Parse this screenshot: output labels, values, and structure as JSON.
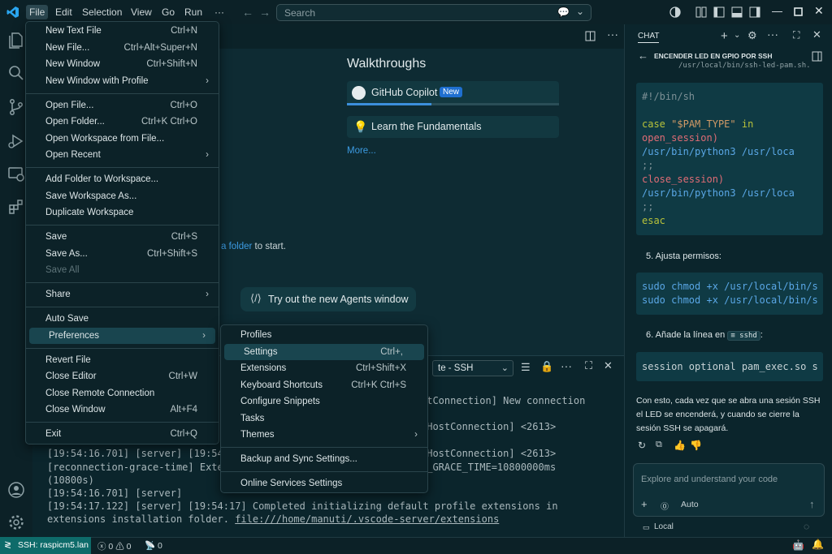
{
  "titlebar": {
    "menus": [
      "File",
      "Edit",
      "Selection",
      "View",
      "Go",
      "Run",
      "···"
    ],
    "search_placeholder": "Search"
  },
  "file_menu": {
    "groups": [
      [
        {
          "label": "New Text File",
          "shortcut": "Ctrl+N"
        },
        {
          "label": "New File...",
          "shortcut": "Ctrl+Alt+Super+N"
        },
        {
          "label": "New Window",
          "shortcut": "Ctrl+Shift+N"
        },
        {
          "label": "New Window with Profile",
          "shortcut": "",
          "submenu": true
        }
      ],
      [
        {
          "label": "Open File...",
          "shortcut": "Ctrl+O"
        },
        {
          "label": "Open Folder...",
          "shortcut": "Ctrl+K Ctrl+O"
        },
        {
          "label": "Open Workspace from File...",
          "shortcut": ""
        },
        {
          "label": "Open Recent",
          "shortcut": "",
          "submenu": true
        }
      ],
      [
        {
          "label": "Add Folder to Workspace...",
          "shortcut": ""
        },
        {
          "label": "Save Workspace As...",
          "shortcut": ""
        },
        {
          "label": "Duplicate Workspace",
          "shortcut": ""
        }
      ],
      [
        {
          "label": "Save",
          "shortcut": "Ctrl+S"
        },
        {
          "label": "Save As...",
          "shortcut": "Ctrl+Shift+S"
        },
        {
          "label": "Save All",
          "shortcut": "",
          "disabled": true
        }
      ],
      [
        {
          "label": "Share",
          "shortcut": "",
          "submenu": true
        }
      ],
      [
        {
          "label": "Auto Save",
          "shortcut": ""
        },
        {
          "label": "Preferences",
          "shortcut": "",
          "submenu": true,
          "highlight": true
        }
      ],
      [
        {
          "label": "Revert File",
          "shortcut": ""
        },
        {
          "label": "Close Editor",
          "shortcut": "Ctrl+W"
        },
        {
          "label": "Close Remote Connection",
          "shortcut": ""
        },
        {
          "label": "Close Window",
          "shortcut": "Alt+F4"
        }
      ],
      [
        {
          "label": "Exit",
          "shortcut": "Ctrl+Q"
        }
      ]
    ]
  },
  "prefs_menu": {
    "groups": [
      [
        {
          "label": "Profiles",
          "shortcut": ""
        },
        {
          "label": "Settings",
          "shortcut": "Ctrl+,",
          "highlight": true
        },
        {
          "label": "Extensions",
          "shortcut": "Ctrl+Shift+X"
        },
        {
          "label": "Keyboard Shortcuts",
          "shortcut": "Ctrl+K Ctrl+S"
        },
        {
          "label": "Configure Snippets",
          "shortcut": ""
        },
        {
          "label": "Tasks",
          "shortcut": ""
        },
        {
          "label": "Themes",
          "shortcut": "",
          "submenu": true
        }
      ],
      [
        {
          "label": "Backup and Sync Settings...",
          "shortcut": ""
        }
      ],
      [
        {
          "label": "Online Services Settings",
          "shortcut": ""
        }
      ]
    ]
  },
  "welcome": {
    "walkthroughs_title": "Walkthroughs",
    "copilot": "GitHub Copilot",
    "new_badge": "New",
    "copilot_progress": 0.4,
    "fundamentals": "Learn the Fundamentals",
    "more": "More...",
    "folder_link": "a folder",
    "folder_suffix": " to start.",
    "agents_button": "Try out the new Agents window"
  },
  "panel": {
    "dropdown": "te - SSH",
    "lines": [
      {
        "text": "ntConnection] New connection",
        "x": "right"
      },
      {
        "text": "nHostConnection] <2613>",
        "x": "right"
      },
      {
        "text": "[19:54:16.701] [server] [19:54",
        "x": "left"
      },
      {
        "text": "nHostConnection] <2613>",
        "x": "right"
      },
      {
        "text": "[reconnection-grace-time] Exte",
        "x": "left"
      },
      {
        "text": "N_GRACE_TIME=10800000ms",
        "x": "right"
      },
      {
        "text": "(10800s)",
        "x": "left"
      },
      {
        "text": "[19:54:16.701] [server]",
        "x": "left"
      },
      {
        "text": "[19:54:17.122] [server] [19:54:17] Completed initializing default profile extensions in",
        "x": "left"
      },
      {
        "text": "extensions installation folder. ",
        "x": "left"
      },
      {
        "text": "file:///home/manuti/.vscode-server/extensions",
        "x": "left"
      }
    ]
  },
  "chat": {
    "tab": "CHAT",
    "title": "ENCENDER LED EN GPIO POR SSH",
    "path_fragment": "/usr/local/bin/ssh-led-pam.sh.",
    "code1": [
      "#!/bin/sh",
      "",
      "case \"$PAM_TYPE\" in",
      "  open_session)",
      "    /usr/bin/python3 /usr/loca",
      "    ;;",
      "  close_session)",
      "    /usr/bin/python3 /usr/loca",
      "    ;;",
      "esac"
    ],
    "step5": "5. Ajusta permisos:",
    "code2": [
      "sudo chmod +x /usr/local/bin/s",
      "sudo chmod +x /usr/local/bin/s"
    ],
    "step6_prefix": "6. Añade la línea en ",
    "step6_chip": "sshd",
    "step6_suffix": ":",
    "code3": "session optional pam_exec.so s",
    "conclusion": "Con esto, cada vez que se abra una sesión SSH el LED se encenderá, y cuando se cierre la sesión SSH se apagará.",
    "input_placeholder": "Explore and understand your code",
    "mode": "Auto",
    "location": "Local"
  },
  "statusbar": {
    "remote": "SSH: raspicm5.lan",
    "errors": "0",
    "warnings": "0",
    "ports": "0"
  }
}
